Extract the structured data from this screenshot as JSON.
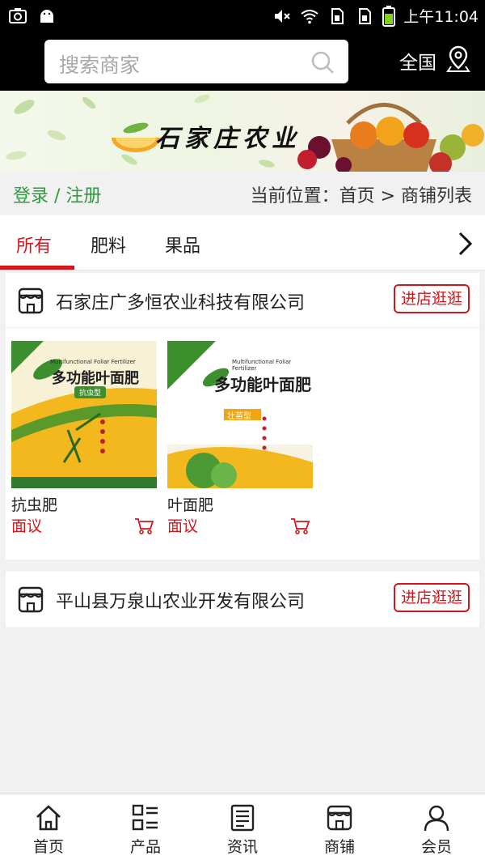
{
  "status_bar": {
    "time": "上午11:04"
  },
  "header": {
    "search_placeholder": "搜索商家",
    "region_label": "全国"
  },
  "banner": {
    "title": "石家庄农业"
  },
  "breadcrumb": {
    "login_label": "登录 / 注册",
    "location_text": "当前位置：首页 > 商铺列表"
  },
  "tabs": [
    {
      "label": "所有",
      "active": true
    },
    {
      "label": "肥料",
      "active": false
    },
    {
      "label": "果品",
      "active": false
    }
  ],
  "shops": [
    {
      "name": "石家庄广多恒农业科技有限公司",
      "visit_label": "进店逛逛",
      "products": [
        {
          "name": "抗虫肥",
          "price": "面议",
          "image_label": "多功能叶面肥",
          "image_sub": "Multifunctional Foliar Fertilizer",
          "badge": "抗虫型"
        },
        {
          "name": "叶面肥",
          "price": "面议",
          "image_label": "多功能叶面肥",
          "image_sub": "Multifunctional Foliar Fertilizer",
          "badge": "壮苗型"
        }
      ]
    },
    {
      "name": "平山县万泉山农业开发有限公司",
      "visit_label": "进店逛逛",
      "products": []
    }
  ],
  "bottom_nav": [
    {
      "label": "首页",
      "icon": "home-icon"
    },
    {
      "label": "产品",
      "icon": "grid-list-icon"
    },
    {
      "label": "资讯",
      "icon": "news-icon"
    },
    {
      "label": "商铺",
      "icon": "shop-icon"
    },
    {
      "label": "会员",
      "icon": "user-icon"
    }
  ],
  "colors": {
    "accent": "#d2161c",
    "green": "#2e9a3e",
    "header_bg": "#000000"
  }
}
